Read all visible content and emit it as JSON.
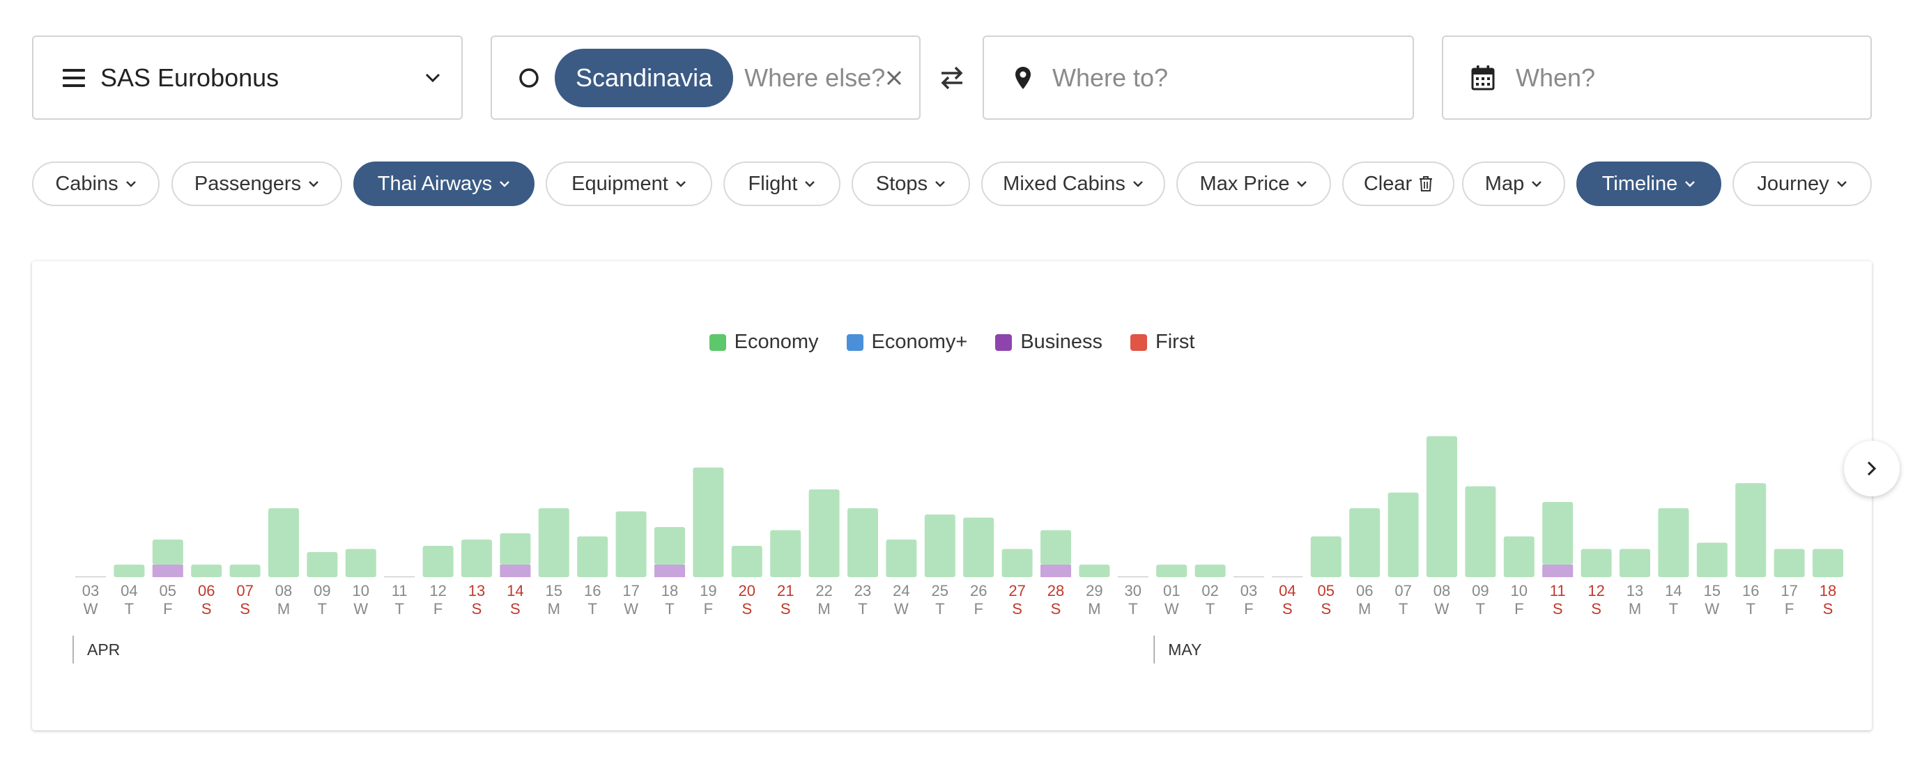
{
  "search": {
    "program": "SAS Eurobonus",
    "origin_chip": "Scandinavia",
    "origin_placeholder": "Where else?",
    "destination_placeholder": "Where to?",
    "date_placeholder": "When?"
  },
  "filters": [
    {
      "label": "Cabins",
      "active": false
    },
    {
      "label": "Passengers",
      "active": false
    },
    {
      "label": "Thai Airways",
      "active": true
    },
    {
      "label": "Equipment",
      "active": false
    },
    {
      "label": "Flight",
      "active": false
    },
    {
      "label": "Stops",
      "active": false
    },
    {
      "label": "Mixed Cabins",
      "active": false
    },
    {
      "label": "Max Price",
      "active": false
    },
    {
      "label": "Clear",
      "active": false
    },
    {
      "label": "Map",
      "active": false
    },
    {
      "label": "Timeline",
      "active": true
    },
    {
      "label": "Journey",
      "active": false
    }
  ],
  "colors": {
    "accent": "#3b5b85",
    "economy": "#b3e3bc",
    "business": "#c9a3dc",
    "weekend": "#c0392b",
    "weekday": "#888888"
  },
  "icons": {
    "program": "menu-icon",
    "origin": "circle-icon",
    "clear_origin": "close-icon",
    "swap": "swap-icon",
    "destination": "map-pin-icon",
    "date": "calendar-icon",
    "clear_filters": "trash-icon",
    "next": "chevron-right-icon"
  },
  "chart_data": {
    "type": "bar",
    "stacked": true,
    "legend": [
      {
        "name": "Economy",
        "color": "#5cc76b"
      },
      {
        "name": "Economy+",
        "color": "#4a90d9"
      },
      {
        "name": "Business",
        "color": "#8e44ad"
      },
      {
        "name": "First",
        "color": "#e05544"
      }
    ],
    "months": [
      {
        "label": "APR",
        "start_index": 0
      },
      {
        "label": "MAY",
        "start_index": 28
      }
    ],
    "days": [
      {
        "d": "03",
        "w": "W",
        "weekend": false,
        "economy": 0,
        "business": 0
      },
      {
        "d": "04",
        "w": "T",
        "weekend": false,
        "economy": 2,
        "business": 0
      },
      {
        "d": "05",
        "w": "F",
        "weekend": false,
        "economy": 4,
        "business": 2
      },
      {
        "d": "06",
        "w": "S",
        "weekend": true,
        "economy": 2,
        "business": 0
      },
      {
        "d": "07",
        "w": "S",
        "weekend": true,
        "economy": 2,
        "business": 0
      },
      {
        "d": "08",
        "w": "M",
        "weekend": false,
        "economy": 11,
        "business": 0
      },
      {
        "d": "09",
        "w": "T",
        "weekend": false,
        "economy": 4,
        "business": 0
      },
      {
        "d": "10",
        "w": "W",
        "weekend": false,
        "economy": 4.5,
        "business": 0
      },
      {
        "d": "11",
        "w": "T",
        "weekend": false,
        "economy": 0,
        "business": 0
      },
      {
        "d": "12",
        "w": "F",
        "weekend": false,
        "economy": 5,
        "business": 0
      },
      {
        "d": "13",
        "w": "S",
        "weekend": true,
        "economy": 6,
        "business": 0
      },
      {
        "d": "14",
        "w": "S",
        "weekend": true,
        "economy": 5,
        "business": 2
      },
      {
        "d": "15",
        "w": "M",
        "weekend": false,
        "economy": 11,
        "business": 0
      },
      {
        "d": "16",
        "w": "T",
        "weekend": false,
        "economy": 6.5,
        "business": 0
      },
      {
        "d": "17",
        "w": "W",
        "weekend": false,
        "economy": 10.5,
        "business": 0
      },
      {
        "d": "18",
        "w": "T",
        "weekend": false,
        "economy": 6,
        "business": 2
      },
      {
        "d": "19",
        "w": "F",
        "weekend": false,
        "economy": 17.5,
        "business": 0
      },
      {
        "d": "20",
        "w": "S",
        "weekend": true,
        "economy": 5,
        "business": 0
      },
      {
        "d": "21",
        "w": "S",
        "weekend": true,
        "economy": 7.5,
        "business": 0
      },
      {
        "d": "22",
        "w": "M",
        "weekend": false,
        "economy": 14,
        "business": 0
      },
      {
        "d": "23",
        "w": "T",
        "weekend": false,
        "economy": 11,
        "business": 0
      },
      {
        "d": "24",
        "w": "W",
        "weekend": false,
        "economy": 6,
        "business": 0
      },
      {
        "d": "25",
        "w": "T",
        "weekend": false,
        "economy": 10,
        "business": 0
      },
      {
        "d": "26",
        "w": "F",
        "weekend": false,
        "economy": 9.5,
        "business": 0
      },
      {
        "d": "27",
        "w": "S",
        "weekend": true,
        "economy": 4.5,
        "business": 0
      },
      {
        "d": "28",
        "w": "S",
        "weekend": true,
        "economy": 5.5,
        "business": 2
      },
      {
        "d": "29",
        "w": "M",
        "weekend": false,
        "economy": 2,
        "business": 0
      },
      {
        "d": "30",
        "w": "T",
        "weekend": false,
        "economy": 0,
        "business": 0
      },
      {
        "d": "01",
        "w": "W",
        "weekend": false,
        "economy": 2,
        "business": 0
      },
      {
        "d": "02",
        "w": "T",
        "weekend": false,
        "economy": 2,
        "business": 0
      },
      {
        "d": "03",
        "w": "F",
        "weekend": false,
        "economy": 0,
        "business": 0
      },
      {
        "d": "04",
        "w": "S",
        "weekend": true,
        "economy": 0,
        "business": 0
      },
      {
        "d": "05",
        "w": "S",
        "weekend": true,
        "economy": 6.5,
        "business": 0
      },
      {
        "d": "06",
        "w": "M",
        "weekend": false,
        "economy": 11,
        "business": 0
      },
      {
        "d": "07",
        "w": "T",
        "weekend": false,
        "economy": 13.5,
        "business": 0
      },
      {
        "d": "08",
        "w": "W",
        "weekend": false,
        "economy": 22.5,
        "business": 0
      },
      {
        "d": "09",
        "w": "T",
        "weekend": false,
        "economy": 14.5,
        "business": 0
      },
      {
        "d": "10",
        "w": "F",
        "weekend": false,
        "economy": 6.5,
        "business": 0
      },
      {
        "d": "11",
        "w": "S",
        "weekend": true,
        "economy": 10,
        "business": 2
      },
      {
        "d": "12",
        "w": "S",
        "weekend": true,
        "economy": 4.5,
        "business": 0
      },
      {
        "d": "13",
        "w": "M",
        "weekend": false,
        "economy": 4.5,
        "business": 0
      },
      {
        "d": "14",
        "w": "T",
        "weekend": false,
        "economy": 11,
        "business": 0
      },
      {
        "d": "15",
        "w": "W",
        "weekend": false,
        "economy": 5.5,
        "business": 0
      },
      {
        "d": "16",
        "w": "T",
        "weekend": false,
        "economy": 15,
        "business": 0
      },
      {
        "d": "17",
        "w": "F",
        "weekend": false,
        "economy": 4.5,
        "business": 0
      },
      {
        "d": "18",
        "w": "S",
        "weekend": true,
        "economy": 4.5,
        "business": 0
      }
    ]
  }
}
